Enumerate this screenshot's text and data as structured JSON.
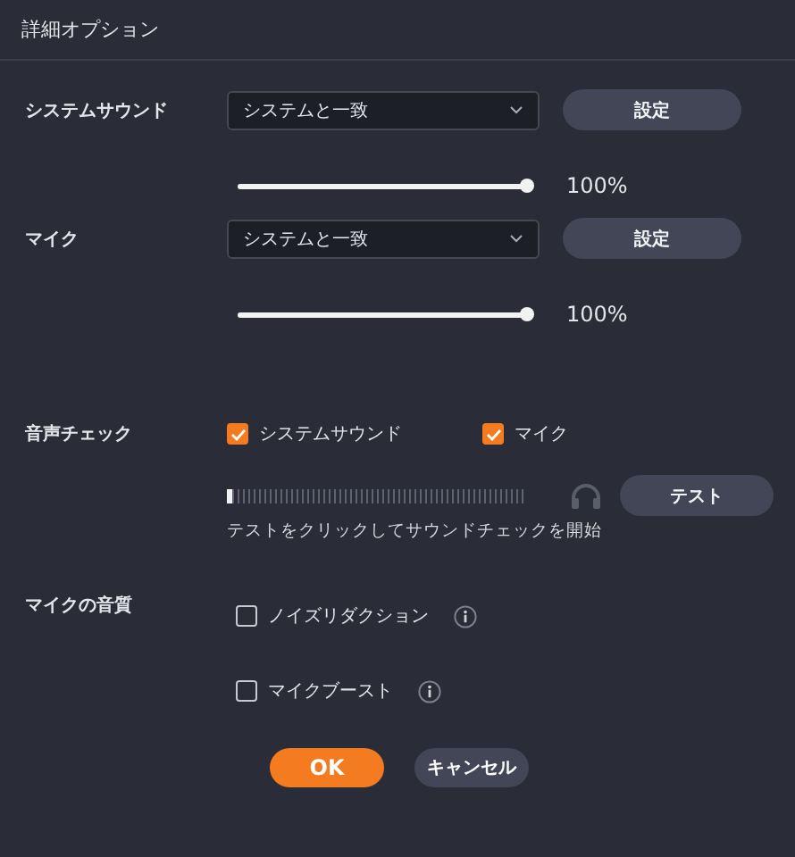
{
  "title": "詳細オプション",
  "devices": [
    {
      "label": "システムサウンド",
      "dropdown": "システムと一致",
      "button": "設定",
      "level": 1,
      "reading": "100%"
    },
    {
      "label": "マイク",
      "dropdown": "システムと一致",
      "button": "設定",
      "level": 1,
      "reading": "100%"
    }
  ],
  "sound_check": {
    "label": "音声チェック",
    "options": [
      {
        "label": "システムサウンド",
        "checked": true
      },
      {
        "label": "マイク",
        "checked": true
      }
    ],
    "level": 0.02,
    "button": "テスト",
    "hint": "テストをクリックしてサウンドチェックを開始"
  },
  "mic_quality": {
    "label": "マイクの音質",
    "options": [
      {
        "label": "ノイズリダクション",
        "checked": false
      },
      {
        "label": "マイクブースト",
        "checked": false
      }
    ]
  },
  "buttons": [
    {
      "label": "OK",
      "kind": "primary"
    },
    {
      "label": "キャンセル",
      "kind": "secondary"
    }
  ]
}
